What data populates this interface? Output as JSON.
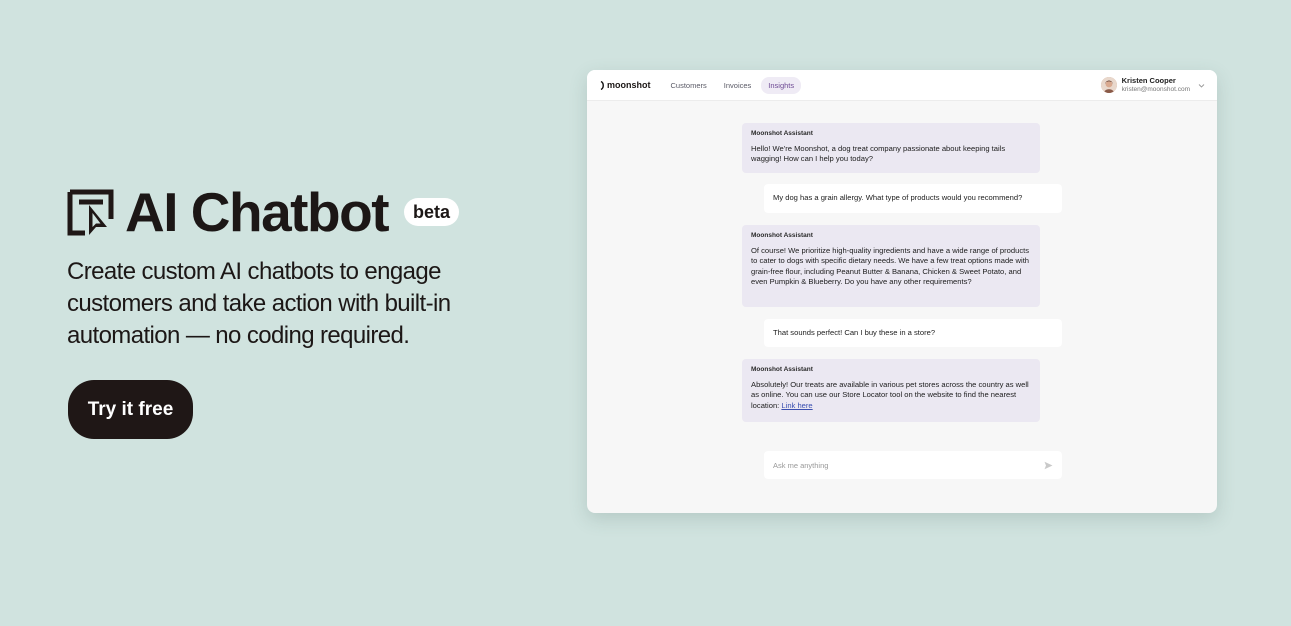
{
  "hero": {
    "title": "AI Chatbot",
    "badge": "beta",
    "subtitle": "Create custom AI chatbots to engage customers and take action with built-in automation — no coding required.",
    "cta_label": "Try it free"
  },
  "app": {
    "brand": "moonshot",
    "nav": [
      {
        "label": "Customers"
      },
      {
        "label": "Invoices"
      },
      {
        "label": "Insights",
        "active": true
      }
    ],
    "user": {
      "name": "Kristen Cooper",
      "email": "kristen@moonshot.com"
    },
    "chat": {
      "messages": [
        {
          "role": "assistant",
          "sender": "Moonshot Assistant",
          "text": "Hello! We're Moonshot, a dog treat company passionate about keeping tails wagging! How can I help you today?"
        },
        {
          "role": "user",
          "text": "My dog has a grain allergy. What type of products would you recommend?"
        },
        {
          "role": "assistant",
          "sender": "Moonshot Assistant",
          "text": "Of course! We prioritize high-quality ingredients and have a wide range of products to cater to dogs with specific dietary needs. We have a few treat options made with grain-free flour, including Peanut Butter & Banana, Chicken & Sweet Potato, and even Pumpkin & Blueberry. Do you have any other requirements?"
        },
        {
          "role": "user",
          "text": "That sounds perfect! Can I buy these in a store?"
        },
        {
          "role": "assistant",
          "sender": "Moonshot Assistant",
          "text": "Absolutely! Our treats are available in various pet stores across the country as well as online. You can use our Store Locator tool on the website to find the nearest location: ",
          "link": "Link here"
        }
      ],
      "input_placeholder": "Ask me anything"
    }
  },
  "colors": {
    "background": "#d0e3df",
    "dark": "#1f1716",
    "assistant_bubble": "#ebe8f2",
    "active_tab": "#6e4a94",
    "link": "#3a4fb0"
  },
  "icons": [
    "chatbot-logo-icon",
    "moonshot-logo-icon",
    "chevron-down-icon",
    "send-icon",
    "avatar"
  ]
}
